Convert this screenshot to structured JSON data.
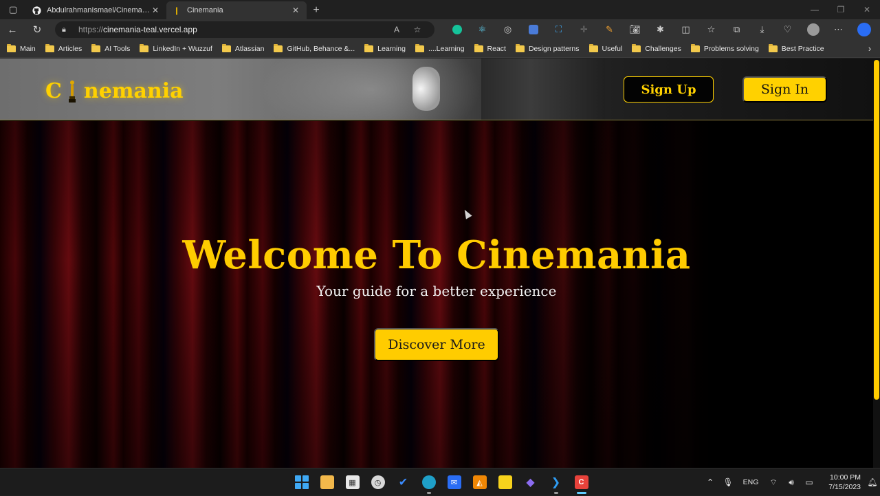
{
  "browser": {
    "tabs": [
      {
        "title": "AbdulrahmanIsmael/Cinemania",
        "favicon": "github-icon",
        "active": false
      },
      {
        "title": "Cinemania",
        "favicon": "oscar-icon",
        "active": true
      }
    ],
    "url_protocol": "https://",
    "url_host": "cinemania-teal.vercel.app",
    "bookmarks": [
      "Main",
      "Articles",
      "AI Tools",
      "LinkedIn + Wuzzuf",
      "Atlassian",
      "GitHub, Behance &...",
      "Learning",
      "....Learning",
      "React",
      "Design patterns",
      "Useful",
      "Challenges",
      "Problems solving",
      "Best Practice"
    ]
  },
  "site": {
    "logo_first": "C",
    "logo_rest": "nemania",
    "sign_up_label": "Sign Up",
    "sign_in_label": "Sign In",
    "hero_title": "Welcome To Cinemania",
    "hero_subtitle": "Your guide for a better experience",
    "discover_label": "Discover More"
  },
  "colors": {
    "accent": "#ffcc00",
    "curtain": "#4a0509"
  },
  "taskbar": {
    "language": "ENG",
    "time": "10:00 PM",
    "date": "7/15/2023"
  }
}
